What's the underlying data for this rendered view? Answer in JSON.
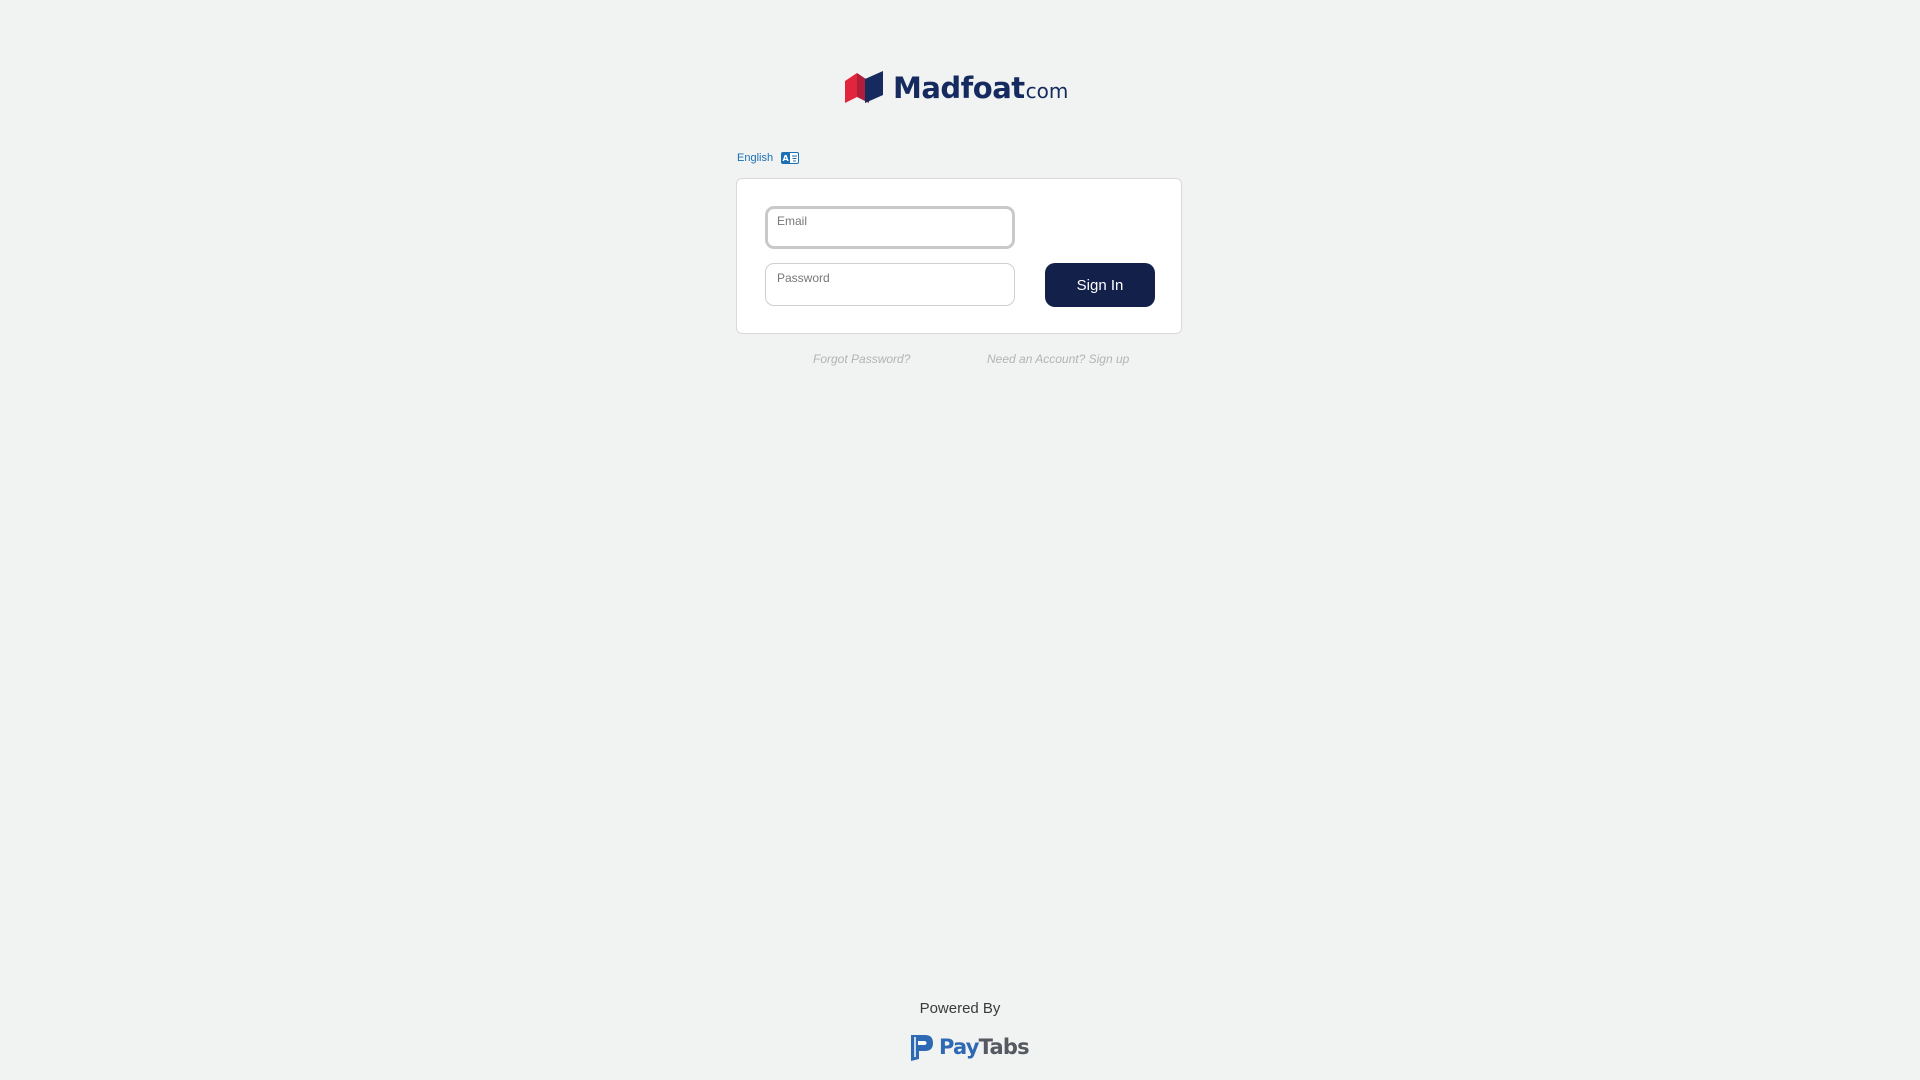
{
  "brand": {
    "name": "Madfoat",
    "tld": "com",
    "colors": {
      "navy": "#152a5e",
      "red": "#e0253d"
    }
  },
  "language": {
    "label": "English",
    "icon": "translate-icon"
  },
  "form": {
    "email": {
      "label": "Email",
      "value": ""
    },
    "password": {
      "label": "Password",
      "value": ""
    },
    "sign_in_label": "Sign In"
  },
  "links": {
    "forgot_password": "Forgot Password?",
    "signup": "Need an Account? Sign up"
  },
  "footer": {
    "powered_by": "Powered By",
    "provider_pay": "Pay",
    "provider_tabs": "Tabs"
  }
}
